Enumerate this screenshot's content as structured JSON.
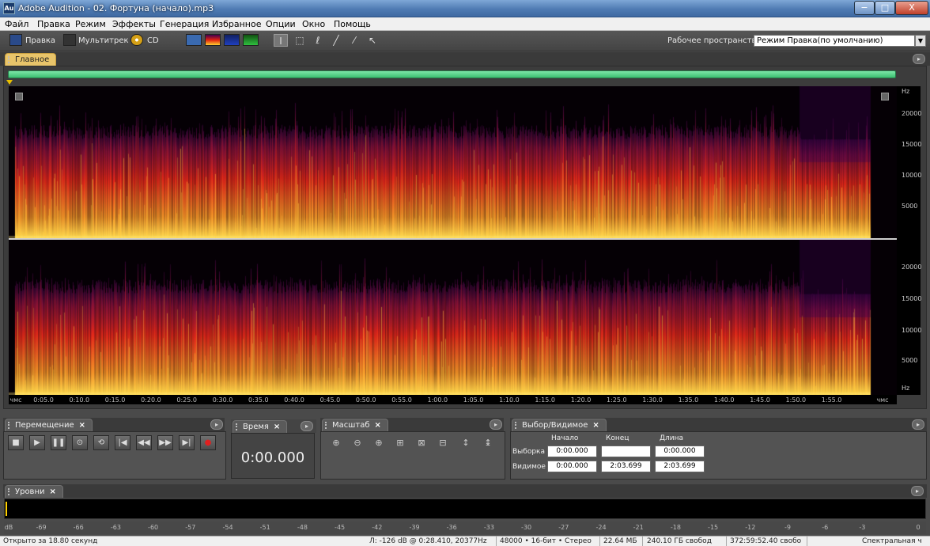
{
  "window": {
    "title": "Adobe Audition - 02. Фортуна (начало).mp3",
    "app_icon": "Au",
    "minimize": "−",
    "maximize": "□",
    "close": "X"
  },
  "menu": {
    "items": [
      "Файл",
      "Правка",
      "Режим",
      "Эффекты",
      "Генерация",
      "Избранное",
      "Опции",
      "Окно",
      "Помощь"
    ]
  },
  "toolbar": {
    "edit_label": "Правка",
    "multitrack_label": "Мультитрек",
    "cd_label": "CD",
    "workspace_label": "Рабочее пространство:",
    "workspace_value": "Режим Правка(по умолчанию)",
    "workspace_arrow": "▼"
  },
  "main_panel": {
    "tab": "Главное",
    "close": "×",
    "menu": "▸"
  },
  "spectral": {
    "hz_unit": "Hz",
    "hz_ticks_top": [
      "20000",
      "15000",
      "10000",
      "5000"
    ],
    "hz_ticks_bottom": [
      "20000",
      "15000",
      "10000",
      "5000"
    ],
    "time_ticks": [
      "чмс",
      "0:05.0",
      "0:10.0",
      "0:15.0",
      "0:20.0",
      "0:25.0",
      "0:30.0",
      "0:35.0",
      "0:40.0",
      "0:45.0",
      "0:50.0",
      "0:55.0",
      "1:00.0",
      "1:05.0",
      "1:10.0",
      "1:15.0",
      "1:20.0",
      "1:25.0",
      "1:30.0",
      "1:35.0",
      "1:40.0",
      "1:45.0",
      "1:50.0",
      "1:55.0",
      "чмс"
    ],
    "colors": {
      "background": "#050005",
      "low": "#5a0a5a",
      "mid": "#e8281a",
      "high": "#ffd23a"
    }
  },
  "transport": {
    "tab": "Перемещение",
    "close": "×",
    "buttons": [
      "■",
      "▶",
      "❚❚",
      "⊙",
      "⟲",
      "|◀",
      "◀◀",
      "▶▶",
      "▶|",
      "●"
    ]
  },
  "time_panel": {
    "tab": "Время",
    "close": "×",
    "value": "0:00.000"
  },
  "zoom_panel": {
    "tab": "Масштаб",
    "close": "×",
    "buttons": [
      "⊕",
      "⊖",
      "⊕",
      "⊞",
      "⊠",
      "⊟",
      "↕",
      "↨"
    ]
  },
  "selection_panel": {
    "tab": "Выбор/Видимое",
    "close": "×",
    "headers": [
      "Начало",
      "Конец",
      "Длина"
    ],
    "rows": [
      {
        "label": "Выборка",
        "start": "0:00.000",
        "end": "",
        "length": "0:00.000"
      },
      {
        "label": "Видимое",
        "start": "0:00.000",
        "end": "2:03.699",
        "length": "2:03.699"
      }
    ]
  },
  "levels_panel": {
    "tab": "Уровни",
    "close": "×",
    "scale": [
      "dB",
      "-69",
      "-66",
      "-63",
      "-60",
      "-57",
      "-54",
      "-51",
      "-48",
      "-45",
      "-42",
      "-39",
      "-36",
      "-33",
      "-30",
      "-27",
      "-24",
      "-21",
      "-18",
      "-15",
      "-12",
      "-9",
      "-6",
      "-3",
      "0"
    ]
  },
  "status": {
    "opened": "Открыто за 18.80 секунд",
    "cursor": "Л: -126 dB @  0:28.410, 20377Hz",
    "format": "48000 • 16-бит • Стерео",
    "size": "22.64 МБ",
    "free_space": "240.10 ГБ свобод",
    "free_time": "372:59:52.40 свобо",
    "view": "Спектральная ч"
  }
}
